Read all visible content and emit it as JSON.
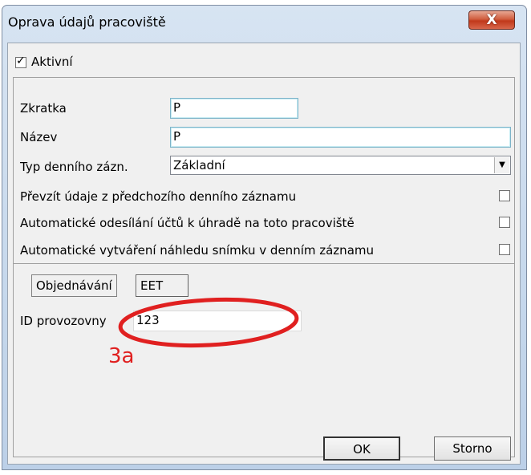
{
  "window": {
    "title": "Oprava údajů pracoviště",
    "close_glyph": "X"
  },
  "active": {
    "label": "Aktivní",
    "checked": true
  },
  "fields": {
    "zkratka": {
      "label": "Zkratka",
      "value": "P"
    },
    "nazev": {
      "label": "Název",
      "value": "P"
    },
    "typ": {
      "label": "Typ denního zázn.",
      "value": "Základní"
    }
  },
  "options": [
    {
      "label": "Převzít údaje z předchozího denního záznamu",
      "checked": false
    },
    {
      "label": "Automatické odesílání účtů k úhradě na toto pracoviště",
      "checked": false
    },
    {
      "label": "Automatické vytváření náhledu snímku v denním záznamu",
      "checked": false
    }
  ],
  "tabs": [
    {
      "label": "Objednávání",
      "active": false
    },
    {
      "label": "EET",
      "active": true
    }
  ],
  "eet": {
    "label": "ID provozovny",
    "value": "123"
  },
  "annotation": {
    "text": "3a",
    "color": "#e02020"
  },
  "buttons": {
    "ok": "OK",
    "cancel": "Storno"
  }
}
